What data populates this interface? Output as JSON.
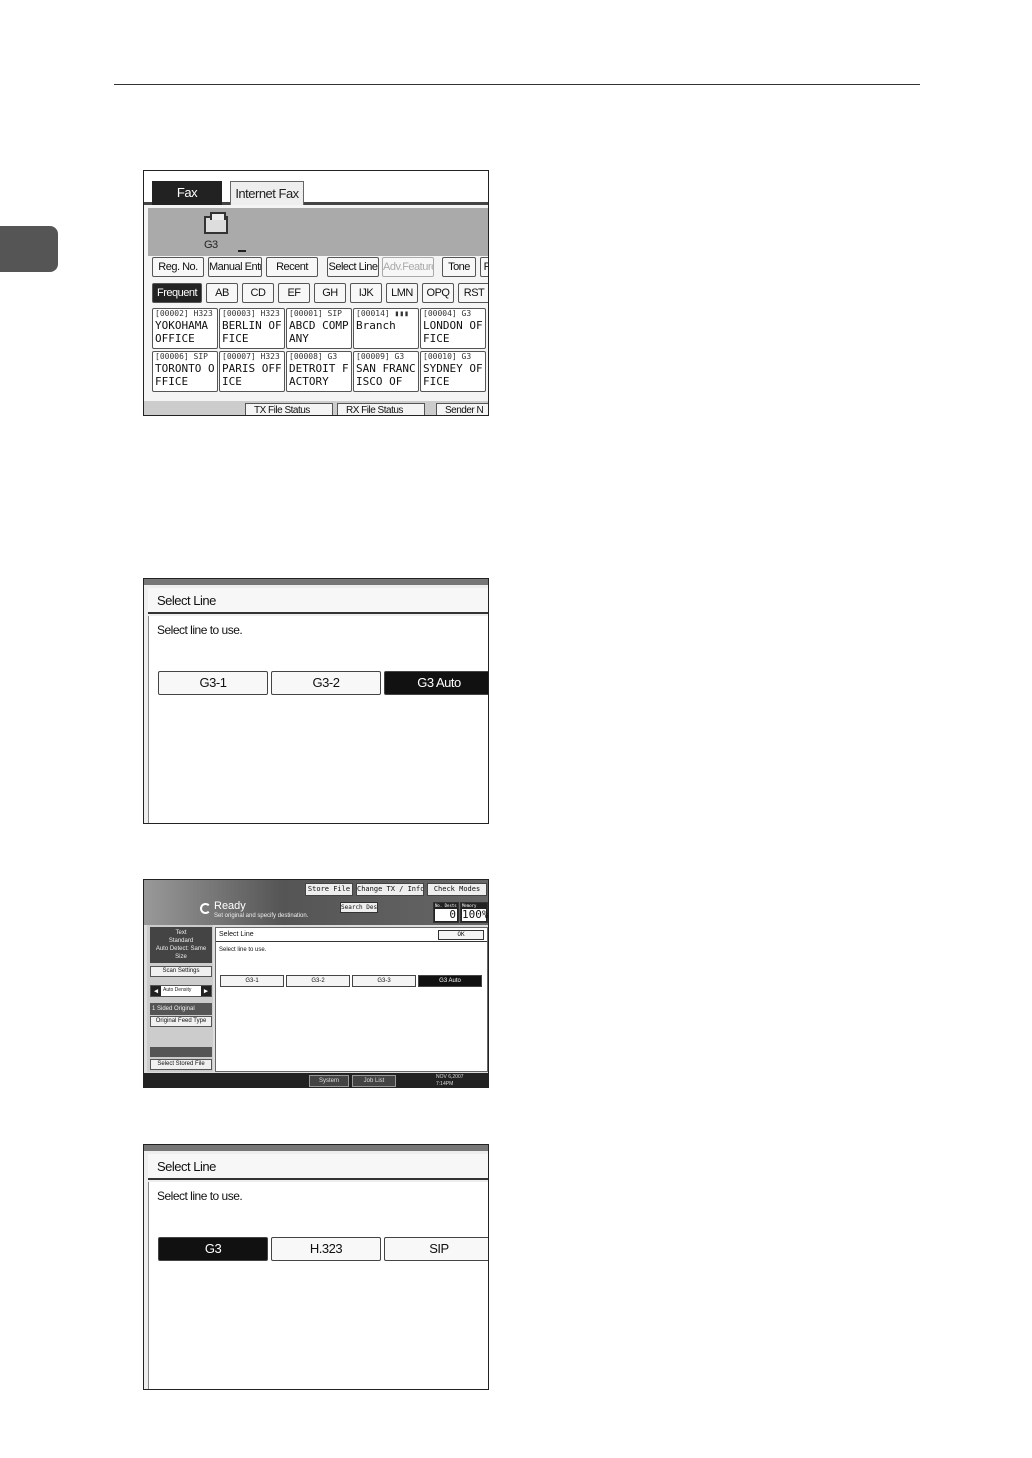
{
  "screen1": {
    "tabs": [
      "Fax",
      "Internet Fax"
    ],
    "line_label": "G3",
    "action_buttons": [
      "Reg. No.",
      "Manual Entry",
      "Recent",
      "Select Line",
      "Adv.Features",
      "Tone",
      "P"
    ],
    "index_tabs": [
      "Frequent",
      "AB",
      "CD",
      "EF",
      "GH",
      "IJK",
      "LMN",
      "OPQ",
      "RST"
    ],
    "destinations": [
      {
        "header": "[00002] H323",
        "name": "YOKOHAMA OFFICE"
      },
      {
        "header": "[00003] H323",
        "name": "BERLIN OFFICE"
      },
      {
        "header": "[00001] SIP",
        "name": "ABCD COMPANY"
      },
      {
        "header": "[00014] ▮▮▮",
        "name": "Branch"
      },
      {
        "header": "[00004] G3",
        "name": "LONDON OFFICE"
      },
      {
        "header": "[00006] SIP",
        "name": "TORONTO OFFICE"
      },
      {
        "header": "[00007] H323",
        "name": "PARIS OFFICE"
      },
      {
        "header": "[00008] G3",
        "name": "DETROIT FACTORY"
      },
      {
        "header": "[00009] G3",
        "name": "SAN FRANCISCO OF"
      },
      {
        "header": "[00010] G3",
        "name": "SYDNEY OFFICE"
      }
    ],
    "bottom_buttons": [
      "TX File Status",
      "RX File Status",
      "Sender N"
    ]
  },
  "screen2": {
    "title": "Select Line",
    "message": "Select line to use.",
    "lines": [
      "G3-1",
      "G3-2",
      "G3 Auto"
    ],
    "selected": "G3 Auto"
  },
  "screen3": {
    "top_buttons": [
      "Store File",
      "Change TX / Info",
      "Check Modes"
    ],
    "status": "Ready",
    "status_sub": "Set original and specify destination.",
    "search_dest": "Search Dest.",
    "meters": [
      {
        "label": "No. Dests",
        "value": "0"
      },
      {
        "label": "Memory",
        "value": "100%"
      }
    ],
    "mode_lines": [
      "Text",
      "Standard",
      "Auto Detect: Same Size"
    ],
    "scan_settings": "Scan Settings",
    "auto_density": "Auto Density",
    "original": "1 Sided Original",
    "feed_type": "Original Feed Type",
    "select_stored": "Select Stored File",
    "dialog_title": "Select Line",
    "ok": "OK",
    "message": "Select line to use.",
    "lines": [
      "G3-1",
      "G3-2",
      "G3-3",
      "G3 Auto"
    ],
    "selected": "G3 Auto",
    "footer_buttons": [
      "System Status",
      "Job List"
    ],
    "date": "NOV 6,2007",
    "time": "7:14PM"
  },
  "screen4": {
    "title": "Select Line",
    "message": "Select line to use.",
    "lines": [
      "G3",
      "H.323",
      "SIP"
    ],
    "selected": "G3"
  }
}
